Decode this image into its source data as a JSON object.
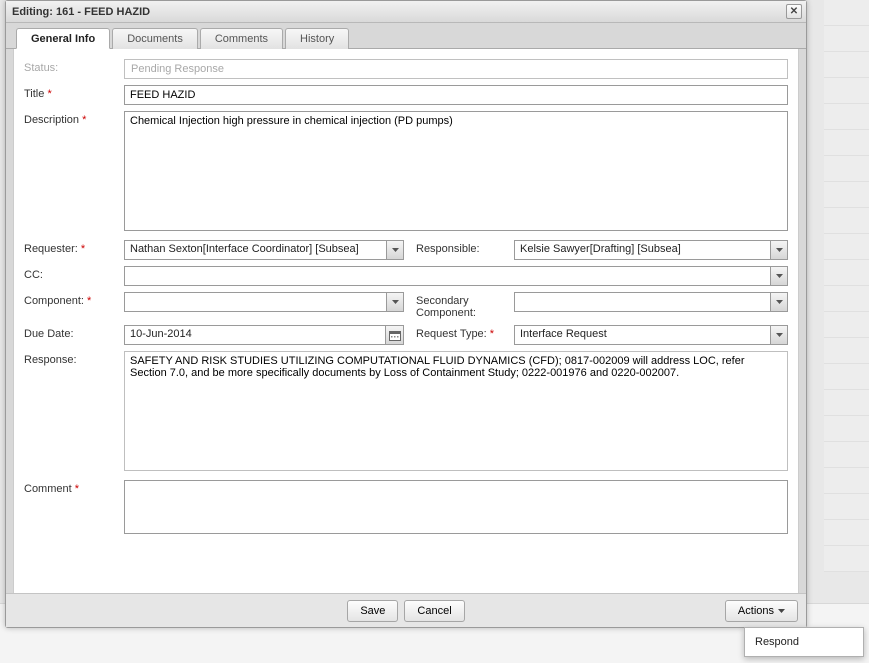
{
  "window": {
    "title": "Editing: 161 - FEED HAZID"
  },
  "tabs": {
    "general": "General Info",
    "documents": "Documents",
    "comments": "Comments",
    "history": "History"
  },
  "labels": {
    "status": "Status:",
    "title": "Title",
    "description": "Description",
    "requester": "Requester:",
    "responsible": "Responsible:",
    "cc": "CC:",
    "component": "Component:",
    "secondary_component": "Secondary Component:",
    "due_date": "Due Date:",
    "request_type": "Request Type:",
    "response": "Response:",
    "comment": "Comment"
  },
  "values": {
    "status": "Pending Response",
    "title": "FEED HAZID",
    "description": "Chemical Injection high pressure in chemical injection (PD pumps)",
    "requester": "Nathan Sexton[Interface Coordinator] [Subsea]",
    "responsible": "Kelsie Sawyer[Drafting] [Subsea]",
    "cc": "",
    "component": "",
    "secondary_component": "",
    "due_date": "10-Jun-2014",
    "request_type": "Interface Request",
    "response": "SAFETY AND RISK STUDIES UTILIZING COMPUTATIONAL FLUID DYNAMICS (CFD); 0817-002009 will address LOC, refer Section 7.0, and be more specifically documents by Loss of Containment Study; 0222-001976 and 0220-002007.",
    "comment": ""
  },
  "buttons": {
    "save": "Save",
    "cancel": "Cancel",
    "actions": "Actions"
  },
  "menu": {
    "respond": "Respond"
  }
}
